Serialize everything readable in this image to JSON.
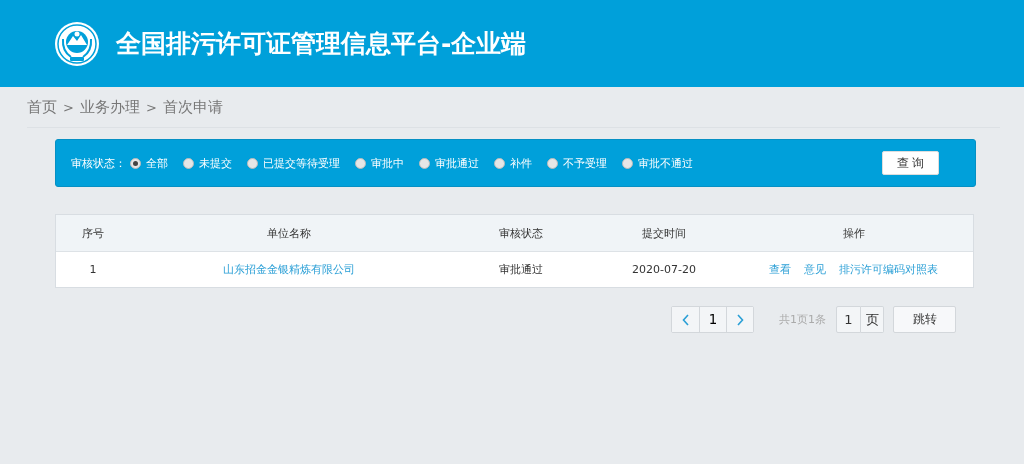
{
  "header": {
    "title": "全国排污许可证管理信息平台-企业端"
  },
  "breadcrumb": {
    "items": [
      "首页",
      "业务办理",
      "首次申请"
    ],
    "separators": [
      ">",
      ">"
    ]
  },
  "filter": {
    "label": "审核状态：",
    "options": [
      {
        "label": "全部",
        "selected": true
      },
      {
        "label": "未提交",
        "selected": false
      },
      {
        "label": "已提交等待受理",
        "selected": false
      },
      {
        "label": "审批中",
        "selected": false
      },
      {
        "label": "审批通过",
        "selected": false
      },
      {
        "label": "补件",
        "selected": false
      },
      {
        "label": "不予受理",
        "selected": false
      },
      {
        "label": "审批不通过",
        "selected": false
      }
    ],
    "button": "查 询"
  },
  "table": {
    "columns": [
      "序号",
      "单位名称",
      "审核状态",
      "提交时间",
      "操作"
    ],
    "rows": [
      {
        "index": "1",
        "company": "山东招金金银精炼有限公司",
        "status": "审批通过",
        "date": "2020-07-20",
        "actions": [
          "查看",
          "意见",
          "排污许可编码对照表"
        ]
      }
    ]
  },
  "pagination": {
    "page": "1",
    "summary": "共1页1条",
    "jump_value": "1",
    "page_unit": "页",
    "jump_button": "跳转"
  }
}
